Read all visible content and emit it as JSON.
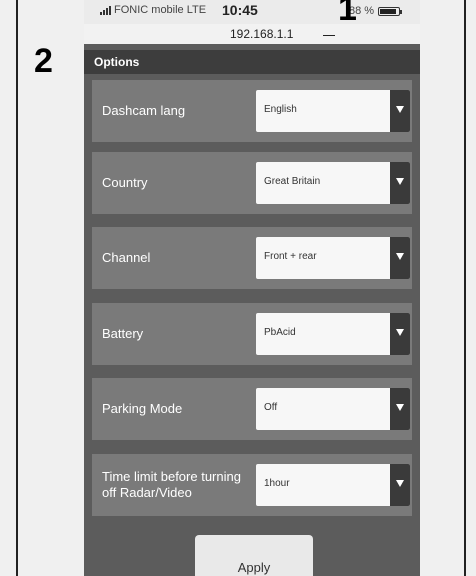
{
  "status_bar": {
    "carrier": "FONIC mobile",
    "network": "LTE",
    "time": "10:45",
    "battery": "88 %"
  },
  "url": "192.168.1.1",
  "callouts": {
    "one": "1",
    "two": "2"
  },
  "header": {
    "title": "Options"
  },
  "settings": [
    {
      "label": "Dashcam lang",
      "value": "English"
    },
    {
      "label": "Country",
      "value": "Great Britain"
    },
    {
      "label": "Channel",
      "value": "Front + rear"
    },
    {
      "label": "Battery",
      "value": "PbAcid"
    },
    {
      "label": "Parking Mode",
      "value": "Off"
    },
    {
      "label": "Time limit before turning off Radar/Video",
      "value": "1hour"
    }
  ],
  "apply_label": "Apply"
}
